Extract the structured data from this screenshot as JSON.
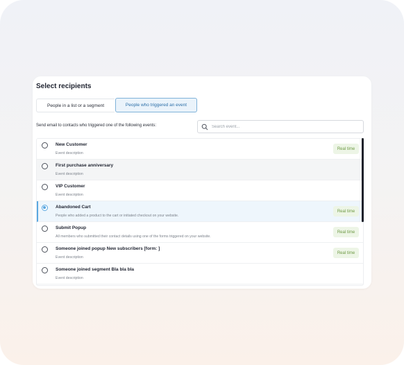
{
  "panel": {
    "title": "Select recipients",
    "tabs": [
      {
        "label": "People in a list or a segment",
        "selected": false
      },
      {
        "label": "People who triggered an event",
        "selected": true
      }
    ],
    "prompt": "Send email to contacts who triggered one of the following events:",
    "search": {
      "placeholder": "Search event...",
      "value": ""
    },
    "events": [
      {
        "title": "New Customer",
        "description": "Event description",
        "badge": "Real time",
        "selected": false
      },
      {
        "title": "First purchase anniversary",
        "description": "Event description",
        "badge": "",
        "selected": false
      },
      {
        "title": "VIP Customer",
        "description": "Event description",
        "badge": "",
        "selected": false
      },
      {
        "title": "Abandoned Cart",
        "description": "People who added a product to the cart or initiated checkout on your website.",
        "badge": "Real time",
        "selected": true
      },
      {
        "title": "Submit Popup",
        "description": "All members who submitted their contact details using one of the forms triggered on your website.",
        "badge": "Real time",
        "selected": false
      },
      {
        "title": "Someone joined popup New subscribers [form:                    ]",
        "description": "Event description",
        "badge": "Real time",
        "selected": false
      },
      {
        "title": "Someone joined segment Bla bla bla",
        "description": "Event description",
        "badge": "",
        "selected": false
      }
    ]
  },
  "colors": {
    "accent": "#5aa7e0",
    "tab_active_bg": "#eaf3fb",
    "badge_bg": "#edf5e6",
    "badge_text": "#6e9a45"
  },
  "icons": {
    "search": "search-icon"
  }
}
